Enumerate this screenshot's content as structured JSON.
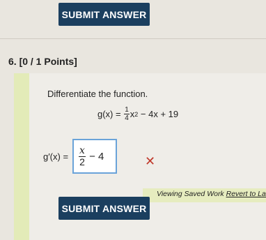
{
  "buttons": {
    "submit_top": "SUBMIT ANSWER",
    "submit_bottom": "SUBMIT ANSWER"
  },
  "question": {
    "header": "6.  [0 / 1 Points]",
    "prompt": "Differentiate the function.",
    "function": {
      "lhs": "g(x) =",
      "coef_num": "1",
      "coef_den": "4",
      "var": "x",
      "exp": "2",
      "rest": "− 4x + 19"
    },
    "derivative_lhs": "g′(x) =",
    "answer": {
      "num": "x",
      "den": "2",
      "rest": "− 4"
    }
  },
  "status": {
    "viewing": "Viewing Saved Work",
    "revert": "Revert to Last"
  },
  "colors": {
    "button": "#1b3f5f",
    "wrong": "#c0392b",
    "field_border": "#6aa3d9"
  },
  "icons": {
    "wrong": "x-mark-icon"
  }
}
